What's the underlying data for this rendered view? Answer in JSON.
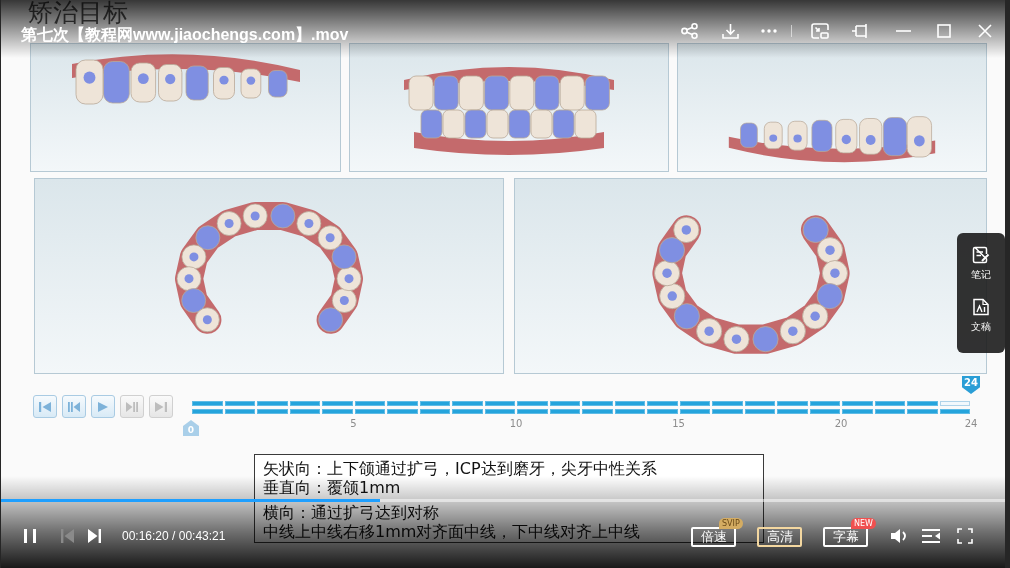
{
  "window": {
    "title": "第七次【教程网www.jiaochengs.com】.mov"
  },
  "slide": {
    "title": "矫治目标",
    "views": [
      {
        "kind": "left-side"
      },
      {
        "kind": "front"
      },
      {
        "kind": "right-side"
      },
      {
        "kind": "upper-arch"
      },
      {
        "kind": "lower-arch"
      }
    ],
    "stage_controls": [
      {
        "kind": "first",
        "disabled": false
      },
      {
        "kind": "previous",
        "disabled": false
      },
      {
        "kind": "play",
        "disabled": false
      },
      {
        "kind": "next",
        "disabled": true
      },
      {
        "kind": "last",
        "disabled": true
      }
    ],
    "start_marker": "0",
    "end_marker": "24",
    "stages": [
      {
        "upper": true,
        "lower": true
      },
      {
        "upper": true,
        "lower": true
      },
      {
        "upper": true,
        "lower": true
      },
      {
        "upper": true,
        "lower": true
      },
      {
        "upper": true,
        "lower": true,
        "tick": "5"
      },
      {
        "upper": true,
        "lower": true
      },
      {
        "upper": true,
        "lower": true
      },
      {
        "upper": true,
        "lower": true
      },
      {
        "upper": true,
        "lower": true
      },
      {
        "upper": true,
        "lower": true,
        "tick": "10"
      },
      {
        "upper": true,
        "lower": true
      },
      {
        "upper": true,
        "lower": true
      },
      {
        "upper": true,
        "lower": true
      },
      {
        "upper": true,
        "lower": true
      },
      {
        "upper": true,
        "lower": true,
        "tick": "15"
      },
      {
        "upper": true,
        "lower": true
      },
      {
        "upper": true,
        "lower": true
      },
      {
        "upper": true,
        "lower": true
      },
      {
        "upper": true,
        "lower": true
      },
      {
        "upper": true,
        "lower": true,
        "tick": "20"
      },
      {
        "upper": true,
        "lower": true
      },
      {
        "upper": true,
        "lower": true
      },
      {
        "upper": true,
        "lower": true
      },
      {
        "upper": false,
        "lower": true,
        "tick": "24"
      }
    ],
    "notes": [
      "矢状向：上下颌通过扩弓，ICP达到磨牙，尖牙中性关系",
      "垂直向：覆颌1mm",
      "横向：通过扩弓达到对称",
      "中线上中线右移1mm对齐面中线，下中线对齐上中线"
    ]
  },
  "side_panel": [
    {
      "kind": "notes",
      "label": "笔记"
    },
    {
      "kind": "transcript",
      "label": "文稿"
    }
  ],
  "progress": {
    "level": 0.377
  },
  "controls": [
    {
      "kind": "pause",
      "disabled": false
    },
    {
      "kind": "previous",
      "disabled": true
    },
    {
      "kind": "next",
      "disabled": false
    }
  ],
  "time": "00:16:20 / 00:43:21",
  "options": [
    {
      "label": "倍速",
      "selected": false,
      "badge": {
        "text": "SVIP",
        "color": "#d4ac62"
      }
    },
    {
      "label": "高清",
      "selected": true
    },
    {
      "label": "字幕",
      "selected": false,
      "badge": {
        "text": "NEW",
        "color": "#f0504f"
      }
    }
  ]
}
